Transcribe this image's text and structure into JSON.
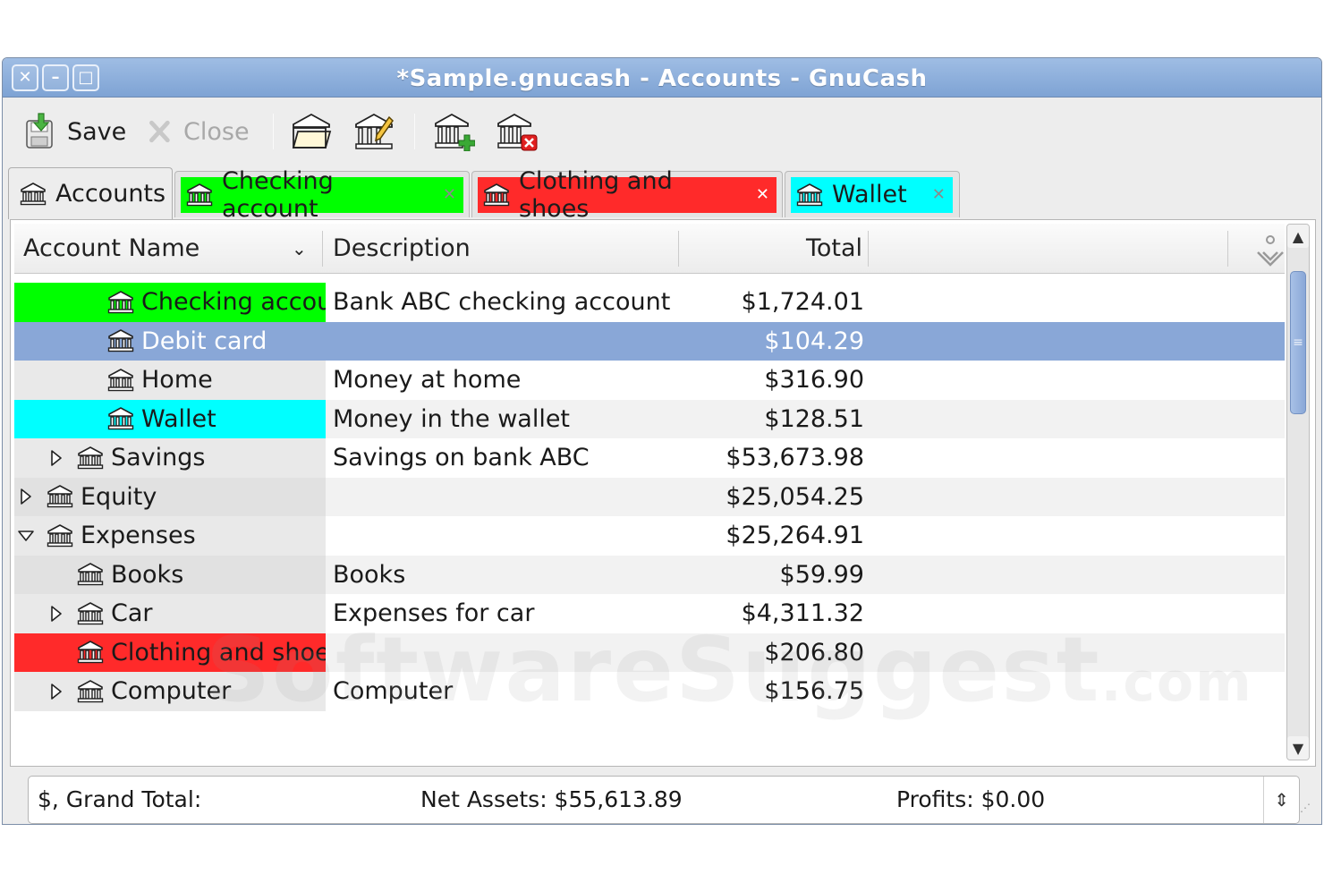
{
  "window": {
    "title": "*Sample.gnucash - Accounts - GnuCash",
    "buttons": [
      "close",
      "minimize",
      "maximize"
    ]
  },
  "toolbar": {
    "save_label": "Save",
    "close_label": "Close",
    "icons": [
      "save-icon",
      "close-icon",
      "open-account-icon",
      "edit-account-icon",
      "new-account-icon",
      "delete-account-icon"
    ]
  },
  "tabs": [
    {
      "label": "Accounts",
      "active": true,
      "color": "#ededed"
    },
    {
      "label": "Checking account",
      "active": false,
      "color": "#00ff00"
    },
    {
      "label": "Clothing and shoes",
      "active": false,
      "color": "#ff2a2a"
    },
    {
      "label": "Wallet",
      "active": false,
      "color": "#00ffff"
    }
  ],
  "columns": {
    "name": "Account Name",
    "description": "Description",
    "total": "Total"
  },
  "rows": [
    {
      "name": "Checking account",
      "description": "Bank ABC checking account",
      "total": "$1,724.01",
      "color": "#00ff00"
    },
    {
      "name": "Debit card",
      "description": "",
      "total": "$104.29",
      "selected": true
    },
    {
      "name": "Home",
      "description": "Money at home",
      "total": "$316.90"
    },
    {
      "name": "Wallet",
      "description": "Money in the wallet",
      "total": "$128.51",
      "color": "#00ffff"
    },
    {
      "name": "Savings",
      "description": "Savings on bank ABC",
      "total": "$53,673.98",
      "expander": "collapsed"
    },
    {
      "name": "Equity",
      "description": "",
      "total": "$25,054.25",
      "expander": "collapsed"
    },
    {
      "name": "Expenses",
      "description": "",
      "total": "$25,264.91",
      "expander": "expanded"
    },
    {
      "name": "Books",
      "description": "Books",
      "total": "$59.99"
    },
    {
      "name": "Car",
      "description": "Expenses for car",
      "total": "$4,311.32",
      "expander": "collapsed"
    },
    {
      "name": "Clothing and shoes",
      "description": "",
      "total": "$206.80",
      "color": "#ff2a2a"
    },
    {
      "name": "Computer",
      "description": "Computer",
      "total": "$156.75",
      "expander": "collapsed"
    }
  ],
  "summary": {
    "label": "$, Grand Total:",
    "net_assets": "Net Assets: $55,613.89",
    "profits": "Profits: $0.00"
  },
  "watermark": {
    "main": "SoftwareSuggest",
    "suffix": ".com"
  }
}
